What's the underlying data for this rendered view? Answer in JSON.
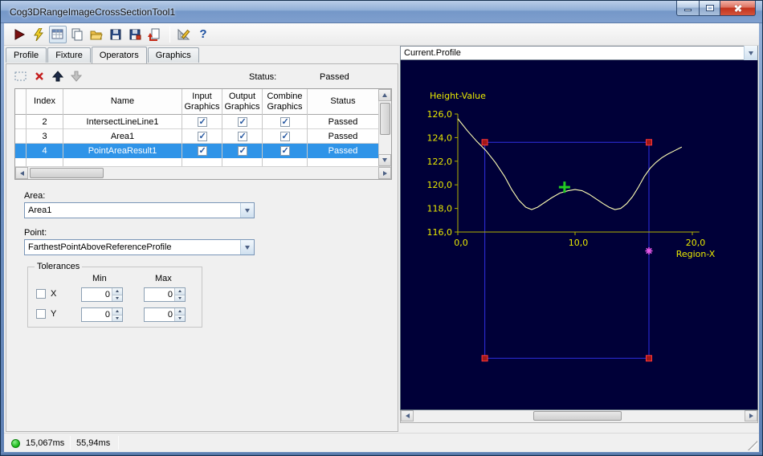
{
  "window": {
    "title": "Cog3DRangeImageCrossSectionTool1"
  },
  "toolbar": {
    "icons": [
      "run-icon",
      "run-continuous-icon",
      "show-results-grid-icon",
      "copy-icon",
      "open-icon",
      "save-icon",
      "save-as-icon",
      "import-icon",
      "measure-tools-icon",
      "help-icon"
    ],
    "help_glyph": "?"
  },
  "tabs": [
    {
      "label": "Profile",
      "active": false
    },
    {
      "label": "Fixture",
      "active": false
    },
    {
      "label": "Operators",
      "active": true
    },
    {
      "label": "Graphics",
      "active": false
    }
  ],
  "operators": {
    "status_label": "Status:",
    "status_value": "Passed",
    "table": {
      "columns": [
        "Index",
        "Name",
        "Input Graphics",
        "Output Graphics",
        "Combine Graphics",
        "Status"
      ],
      "rows": [
        {
          "index": "2",
          "name": "IntersectLineLine1",
          "input": true,
          "output": true,
          "combine": true,
          "status": "Passed",
          "selected": false
        },
        {
          "index": "3",
          "name": "Area1",
          "input": true,
          "output": true,
          "combine": true,
          "status": "Passed",
          "selected": false
        },
        {
          "index": "4",
          "name": "PointAreaResult1",
          "input": true,
          "output": true,
          "combine": true,
          "status": "Passed",
          "selected": true
        }
      ]
    },
    "area_label": "Area:",
    "area_value": "Area1",
    "point_label": "Point:",
    "point_value": "FarthestPointAboveReferenceProfile",
    "tolerances": {
      "title": "Tolerances",
      "min_header": "Min",
      "max_header": "Max",
      "rows": [
        {
          "label": "X",
          "checked": false,
          "min": "0",
          "max": "0"
        },
        {
          "label": "Y",
          "checked": false,
          "min": "0",
          "max": "0"
        }
      ]
    }
  },
  "display": {
    "selector_value": "Current.Profile"
  },
  "chart_data": {
    "type": "line",
    "title": "Current.Profile",
    "ylabel": "Height-Value",
    "xlabel": "Region-X",
    "background": "#000038",
    "axis_color": "#b4b400",
    "label_color": "#e8e800",
    "ylim": [
      116,
      126
    ],
    "xlim": [
      0,
      20.6
    ],
    "grid": false,
    "legend": "none",
    "y_ticks": {
      "values": [
        126,
        124,
        122,
        120,
        118,
        116
      ],
      "labels": [
        "126,0",
        "124,0",
        "122,0",
        "120,0",
        "118,0",
        "116,0"
      ]
    },
    "x_ticks": {
      "values": [
        0,
        10,
        20
      ],
      "labels": [
        "0,0",
        "10,0",
        "20,0"
      ]
    },
    "series": [
      {
        "name": "Current.Profile",
        "color": "#ffffb4",
        "x": [
          0,
          0.8,
          1.6,
          2.4,
          3.2,
          4.0,
          4.6,
          5.2,
          5.8,
          6.3,
          6.8,
          7.4,
          8.0,
          8.7,
          9.4,
          10.0,
          10.6,
          11.2,
          11.8,
          12.4,
          12.9,
          13.4,
          13.9,
          14.4,
          14.9,
          15.4,
          15.9,
          16.4,
          16.9,
          17.4,
          17.9,
          18.5,
          19.1
        ],
        "y": [
          125.6,
          124.6,
          123.7,
          122.9,
          121.9,
          120.7,
          119.6,
          118.7,
          118.1,
          117.9,
          118.1,
          118.5,
          118.9,
          119.3,
          119.5,
          119.6,
          119.5,
          119.2,
          118.8,
          118.4,
          118.1,
          117.9,
          118.0,
          118.4,
          119.0,
          119.8,
          120.7,
          121.4,
          121.9,
          122.3,
          122.6,
          122.9,
          123.2
        ]
      }
    ],
    "region_box": {
      "x0": 2.3,
      "x1": 16.3,
      "y_top": 123.6,
      "y_bottom": 105.3,
      "stroke": "#2828c8",
      "corner_fill": "#a01818",
      "corner_stroke": "#ff3838"
    },
    "markers": [
      {
        "type": "cross",
        "x": 9.1,
        "y": 119.8,
        "color": "#22cc22"
      },
      {
        "type": "star",
        "x": 16.3,
        "y": 114.4,
        "color": "#e858e8"
      }
    ]
  },
  "statusbar": {
    "time1": "15,067ms",
    "time2": "55,94ms"
  }
}
